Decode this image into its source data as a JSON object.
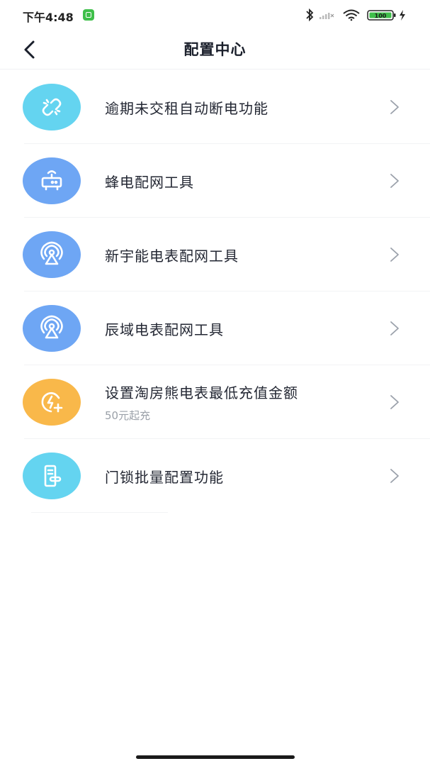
{
  "status_bar": {
    "time": "下午4:48",
    "battery": "100"
  },
  "header": {
    "title": "配置中心",
    "back_icon": "chevron-left-icon"
  },
  "items": [
    {
      "label": "逾期未交租自动断电功能",
      "subtitle": "",
      "icon": "broken-link-icon",
      "icon_bg": "#64d4f0"
    },
    {
      "label": "蜂电配网工具",
      "subtitle": "",
      "icon": "router-icon",
      "icon_bg": "#6ea6f4"
    },
    {
      "label": "新宇能电表配网工具",
      "subtitle": "",
      "icon": "signal-tower-icon",
      "icon_bg": "#6ea6f4"
    },
    {
      "label": "辰域电表配网工具",
      "subtitle": "",
      "icon": "signal-tower-icon",
      "icon_bg": "#6ea6f4"
    },
    {
      "label": "设置淘房熊电表最低充值金额",
      "subtitle": "50元起充",
      "icon": "charge-plus-icon",
      "icon_bg": "#f9b84a"
    },
    {
      "label": "门锁批量配置功能",
      "subtitle": "",
      "icon": "door-lock-icon",
      "icon_bg": "#64d4f0"
    }
  ]
}
